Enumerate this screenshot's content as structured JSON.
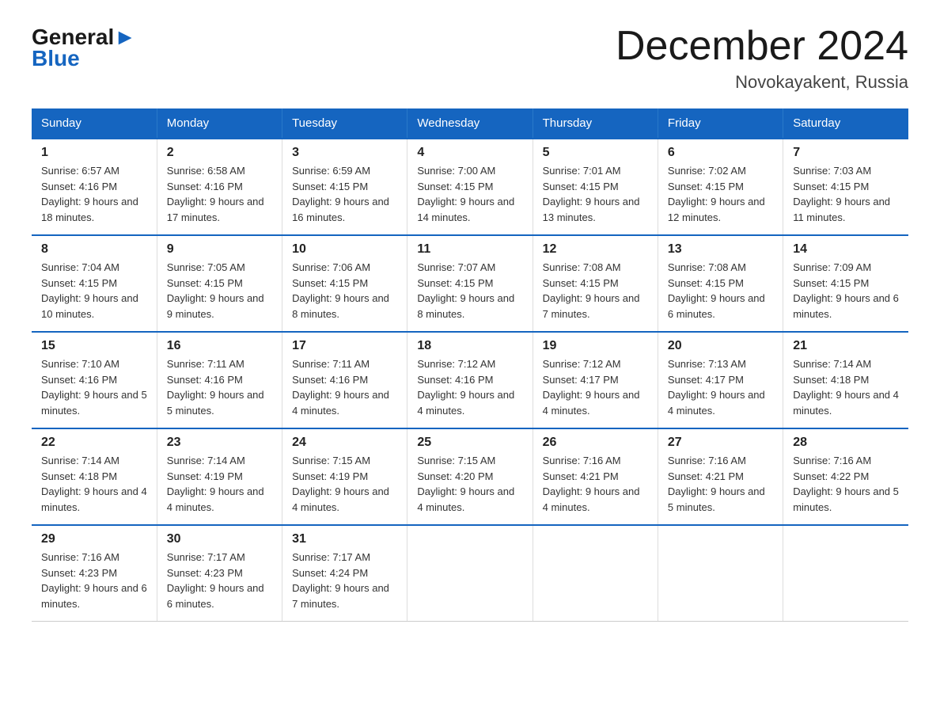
{
  "logo": {
    "general": "General",
    "blue": "Blue"
  },
  "title": "December 2024",
  "location": "Novokayakent, Russia",
  "days_header": [
    "Sunday",
    "Monday",
    "Tuesday",
    "Wednesday",
    "Thursday",
    "Friday",
    "Saturday"
  ],
  "weeks": [
    [
      {
        "day": "1",
        "sunrise": "6:57 AM",
        "sunset": "4:16 PM",
        "daylight": "9 hours and 18 minutes."
      },
      {
        "day": "2",
        "sunrise": "6:58 AM",
        "sunset": "4:16 PM",
        "daylight": "9 hours and 17 minutes."
      },
      {
        "day": "3",
        "sunrise": "6:59 AM",
        "sunset": "4:15 PM",
        "daylight": "9 hours and 16 minutes."
      },
      {
        "day": "4",
        "sunrise": "7:00 AM",
        "sunset": "4:15 PM",
        "daylight": "9 hours and 14 minutes."
      },
      {
        "day": "5",
        "sunrise": "7:01 AM",
        "sunset": "4:15 PM",
        "daylight": "9 hours and 13 minutes."
      },
      {
        "day": "6",
        "sunrise": "7:02 AM",
        "sunset": "4:15 PM",
        "daylight": "9 hours and 12 minutes."
      },
      {
        "day": "7",
        "sunrise": "7:03 AM",
        "sunset": "4:15 PM",
        "daylight": "9 hours and 11 minutes."
      }
    ],
    [
      {
        "day": "8",
        "sunrise": "7:04 AM",
        "sunset": "4:15 PM",
        "daylight": "9 hours and 10 minutes."
      },
      {
        "day": "9",
        "sunrise": "7:05 AM",
        "sunset": "4:15 PM",
        "daylight": "9 hours and 9 minutes."
      },
      {
        "day": "10",
        "sunrise": "7:06 AM",
        "sunset": "4:15 PM",
        "daylight": "9 hours and 8 minutes."
      },
      {
        "day": "11",
        "sunrise": "7:07 AM",
        "sunset": "4:15 PM",
        "daylight": "9 hours and 8 minutes."
      },
      {
        "day": "12",
        "sunrise": "7:08 AM",
        "sunset": "4:15 PM",
        "daylight": "9 hours and 7 minutes."
      },
      {
        "day": "13",
        "sunrise": "7:08 AM",
        "sunset": "4:15 PM",
        "daylight": "9 hours and 6 minutes."
      },
      {
        "day": "14",
        "sunrise": "7:09 AM",
        "sunset": "4:15 PM",
        "daylight": "9 hours and 6 minutes."
      }
    ],
    [
      {
        "day": "15",
        "sunrise": "7:10 AM",
        "sunset": "4:16 PM",
        "daylight": "9 hours and 5 minutes."
      },
      {
        "day": "16",
        "sunrise": "7:11 AM",
        "sunset": "4:16 PM",
        "daylight": "9 hours and 5 minutes."
      },
      {
        "day": "17",
        "sunrise": "7:11 AM",
        "sunset": "4:16 PM",
        "daylight": "9 hours and 4 minutes."
      },
      {
        "day": "18",
        "sunrise": "7:12 AM",
        "sunset": "4:16 PM",
        "daylight": "9 hours and 4 minutes."
      },
      {
        "day": "19",
        "sunrise": "7:12 AM",
        "sunset": "4:17 PM",
        "daylight": "9 hours and 4 minutes."
      },
      {
        "day": "20",
        "sunrise": "7:13 AM",
        "sunset": "4:17 PM",
        "daylight": "9 hours and 4 minutes."
      },
      {
        "day": "21",
        "sunrise": "7:14 AM",
        "sunset": "4:18 PM",
        "daylight": "9 hours and 4 minutes."
      }
    ],
    [
      {
        "day": "22",
        "sunrise": "7:14 AM",
        "sunset": "4:18 PM",
        "daylight": "9 hours and 4 minutes."
      },
      {
        "day": "23",
        "sunrise": "7:14 AM",
        "sunset": "4:19 PM",
        "daylight": "9 hours and 4 minutes."
      },
      {
        "day": "24",
        "sunrise": "7:15 AM",
        "sunset": "4:19 PM",
        "daylight": "9 hours and 4 minutes."
      },
      {
        "day": "25",
        "sunrise": "7:15 AM",
        "sunset": "4:20 PM",
        "daylight": "9 hours and 4 minutes."
      },
      {
        "day": "26",
        "sunrise": "7:16 AM",
        "sunset": "4:21 PM",
        "daylight": "9 hours and 4 minutes."
      },
      {
        "day": "27",
        "sunrise": "7:16 AM",
        "sunset": "4:21 PM",
        "daylight": "9 hours and 5 minutes."
      },
      {
        "day": "28",
        "sunrise": "7:16 AM",
        "sunset": "4:22 PM",
        "daylight": "9 hours and 5 minutes."
      }
    ],
    [
      {
        "day": "29",
        "sunrise": "7:16 AM",
        "sunset": "4:23 PM",
        "daylight": "9 hours and 6 minutes."
      },
      {
        "day": "30",
        "sunrise": "7:17 AM",
        "sunset": "4:23 PM",
        "daylight": "9 hours and 6 minutes."
      },
      {
        "day": "31",
        "sunrise": "7:17 AM",
        "sunset": "4:24 PM",
        "daylight": "9 hours and 7 minutes."
      },
      null,
      null,
      null,
      null
    ]
  ]
}
